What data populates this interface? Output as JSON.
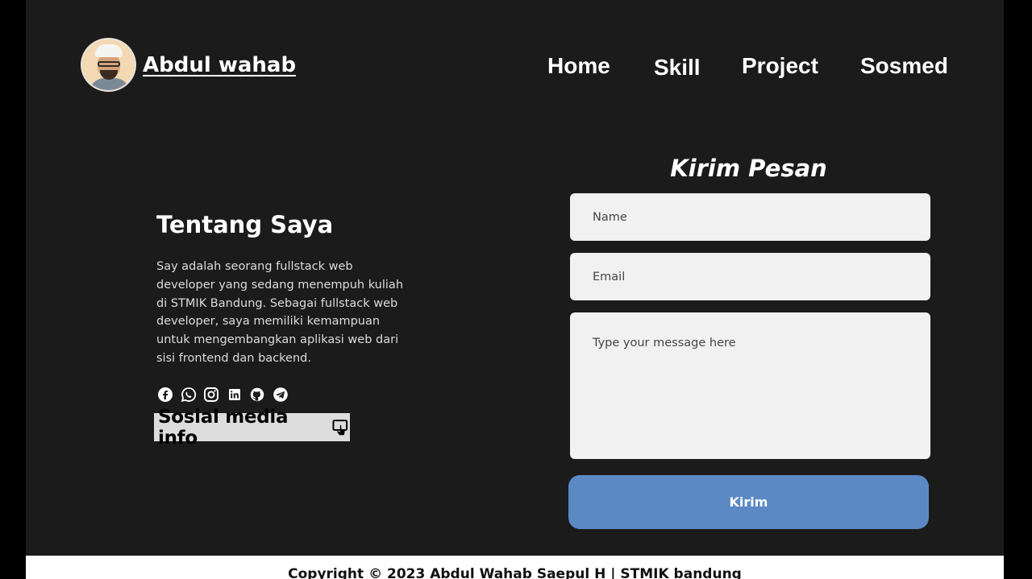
{
  "header": {
    "brand_name": "Abdul wahab",
    "nav": [
      "Home",
      "Skill",
      "Project",
      "Sosmed"
    ]
  },
  "about": {
    "title": "Tentang Saya",
    "text": "Say adalah seorang fullstack web developer yang sedang menempuh kuliah di STMIK Bandung. Sebagai fullstack web developer, saya memiliki kemampuan untuk mengembangkan aplikasi web dari sisi frontend dan backend.",
    "social_icons": [
      "facebook-icon",
      "whatsapp-icon",
      "instagram-icon",
      "linkedin-icon",
      "github-icon",
      "telegram-icon"
    ],
    "info_label": "Sosial media info",
    "info_icon": "touch-screen-icon"
  },
  "form": {
    "title": "Kirim Pesan",
    "name_placeholder": "Name",
    "email_placeholder": "Email",
    "message_placeholder": "Type your message here",
    "submit_label": "Kirim"
  },
  "footer": {
    "copyright": "Copyright © 2023 Abdul Wahab Saepul H | STMIK bandung"
  },
  "colors": {
    "background": "#1b1b1b",
    "outer": "#000000",
    "field": "#f1f1f1",
    "button": "#5b89c3",
    "info_box": "#dcdcdc",
    "footer": "#ffffff"
  }
}
